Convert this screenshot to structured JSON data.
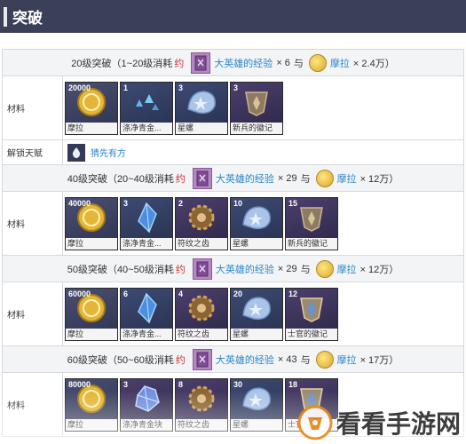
{
  "page": {
    "title": "突破"
  },
  "labels": {
    "materials": "材料",
    "unlock_talent": "解锁天赋"
  },
  "ascensions": [
    {
      "level_text": "20级突破（1~20级消耗",
      "about": "约",
      "exp_label": "大英雄的经验",
      "exp_qty": "× 6",
      "connector": "与",
      "mora_label": "摩拉",
      "mora_qty": "× 2.4万）",
      "materials": [
        {
          "count": "20000",
          "name": "摩拉",
          "icon": "mora-icon"
        },
        {
          "count": "1",
          "name": "涤净青金...",
          "icon": "crystal-shards-icon"
        },
        {
          "count": "3",
          "name": "星螺",
          "icon": "starconch-icon"
        },
        {
          "count": "3",
          "name": "新兵的徽记",
          "icon": "insignia-icon"
        }
      ],
      "talent": {
        "name": "猜先有方",
        "icon": "water-drop-icon"
      }
    },
    {
      "level_text": "40级突破（20~40级消耗",
      "about": "约",
      "exp_label": "大英雄的经验",
      "exp_qty": "× 29",
      "connector": "与",
      "mora_label": "摩拉",
      "mora_qty": "× 12万）",
      "materials": [
        {
          "count": "40000",
          "name": "摩拉",
          "icon": "mora-icon"
        },
        {
          "count": "3",
          "name": "涤净青金...",
          "icon": "crystal-fragment-icon"
        },
        {
          "count": "2",
          "name": "符纹之齿",
          "icon": "gear-tooth-icon"
        },
        {
          "count": "10",
          "name": "星螺",
          "icon": "starconch-icon"
        },
        {
          "count": "15",
          "name": "新兵的徽记",
          "icon": "insignia-icon"
        }
      ]
    },
    {
      "level_text": "50级突破（40~50级消耗",
      "about": "约",
      "exp_label": "大英雄的经验",
      "exp_qty": "× 29",
      "connector": "与",
      "mora_label": "摩拉",
      "mora_qty": "× 12万）",
      "materials": [
        {
          "count": "60000",
          "name": "摩拉",
          "icon": "mora-icon"
        },
        {
          "count": "6",
          "name": "涤净青金...",
          "icon": "crystal-fragment-icon"
        },
        {
          "count": "4",
          "name": "符纹之齿",
          "icon": "gear-tooth-icon"
        },
        {
          "count": "20",
          "name": "星螺",
          "icon": "starconch-icon"
        },
        {
          "count": "12",
          "name": "士官的徽记",
          "icon": "insignia-icon"
        }
      ]
    },
    {
      "level_text": "60级突破（50~60级消耗",
      "about": "约",
      "exp_label": "大英雄的经验",
      "exp_qty": "× 43",
      "connector": "与",
      "mora_label": "摩拉",
      "mora_qty": "× 17万）",
      "materials": [
        {
          "count": "80000",
          "name": "摩拉",
          "icon": "mora-icon"
        },
        {
          "count": "3",
          "name": "涤净青金块",
          "icon": "crystal-chunk-icon"
        },
        {
          "count": "8",
          "name": "符纹之齿",
          "icon": "gear-tooth-icon"
        },
        {
          "count": "30",
          "name": "星螺",
          "icon": "starconch-icon"
        },
        {
          "count": "18",
          "name": "士官的徽记",
          "icon": "insignia-icon"
        }
      ]
    }
  ],
  "watermark": {
    "text": "看看手游网"
  },
  "colors": {
    "title_bar": "#3b3f58",
    "link_blue": "#2a86c8",
    "about_red": "#d63030"
  }
}
